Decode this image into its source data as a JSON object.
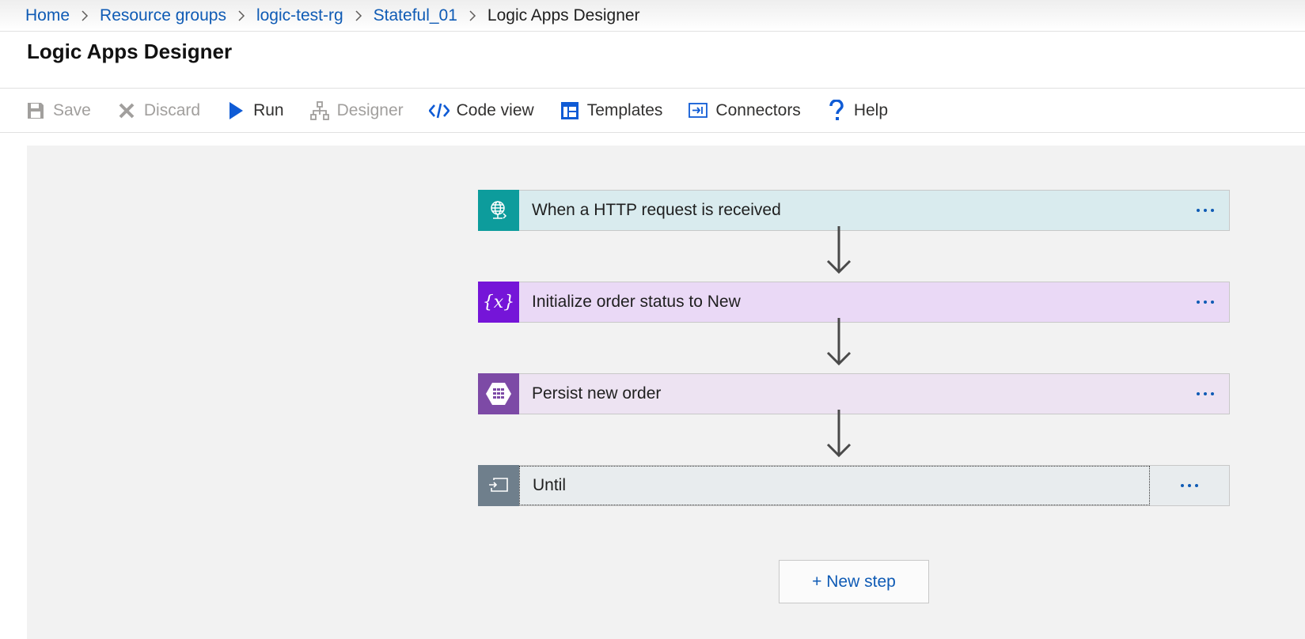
{
  "breadcrumb": {
    "items": [
      "Home",
      "Resource groups",
      "logic-test-rg",
      "Stateful_01"
    ],
    "current": "Logic Apps Designer"
  },
  "page": {
    "title": "Logic Apps Designer"
  },
  "toolbar": {
    "save": {
      "label": "Save",
      "icon": "save-icon",
      "enabled": false
    },
    "discard": {
      "label": "Discard",
      "icon": "discard-icon",
      "enabled": false
    },
    "run": {
      "label": "Run",
      "icon": "play-icon",
      "enabled": true
    },
    "designer": {
      "label": "Designer",
      "icon": "designer-icon",
      "enabled": false
    },
    "code_view": {
      "label": "Code view",
      "icon": "code-icon",
      "enabled": true
    },
    "templates": {
      "label": "Templates",
      "icon": "templates-icon",
      "enabled": true
    },
    "connectors": {
      "label": "Connectors",
      "icon": "connectors-icon",
      "enabled": true
    },
    "help": {
      "label": "Help",
      "icon": "help-icon",
      "enabled": true
    }
  },
  "workflow": {
    "steps": [
      {
        "title": "When a HTTP request is received",
        "icon": "http-request-icon",
        "color": "#0d9c9c"
      },
      {
        "title": "Initialize order status to New",
        "icon": "variable-icon",
        "icon_text": "{x}",
        "color": "#7515d8"
      },
      {
        "title": "Persist new order",
        "icon": "table-storage-icon",
        "color": "#7d4aa6"
      },
      {
        "title": "Until",
        "icon": "until-loop-icon",
        "color": "#6f7f8c"
      }
    ],
    "new_step_label": "+ New step"
  },
  "colors": {
    "link": "#0f5bb5",
    "canvas": "#f2f2f2",
    "disabled": "#a19f9d"
  }
}
